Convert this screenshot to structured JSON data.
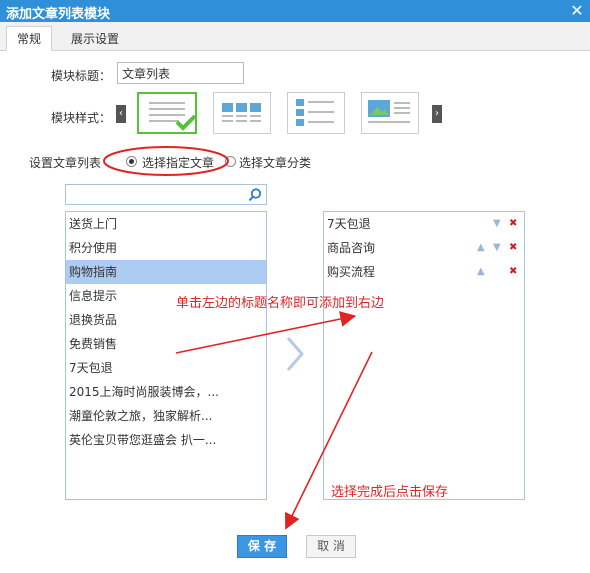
{
  "dialog": {
    "title": "添加文章列表模块",
    "close_glyph": "✕"
  },
  "tabs": [
    {
      "label": "常规"
    },
    {
      "label": "展示设置"
    }
  ],
  "form": {
    "module_title_label": "模块标题：",
    "module_title_value": "文章列表",
    "module_style_label": "模块样式：",
    "article_list_label": "设置文章列表",
    "radio_specific": "选择指定文章",
    "radio_category": "选择文章分类",
    "search_placeholder": ""
  },
  "left_list": [
    "送货上门",
    "积分使用",
    "购物指南",
    "信息提示",
    "退换货品",
    "免费销售",
    "7天包退",
    "2015上海时尚服装博会，...",
    "潮童伦敦之旅，独家解析...",
    "英伦宝贝带您逛盛会 扒一..."
  ],
  "left_selected_index": 2,
  "right_list": [
    {
      "label": "7天包退"
    },
    {
      "label": "商品咨询"
    },
    {
      "label": "购买流程"
    }
  ],
  "buttons": {
    "save": "保 存",
    "cancel": "取 消"
  },
  "annotations": {
    "tip_add": "单击左边的标题名称即可添加到右边",
    "tip_save": "选择完成后点击保存"
  },
  "colors": {
    "titlebar": "#2f8fd8",
    "annotation": "#e02424",
    "selected_row": "#acccf3",
    "save_button": "#3b97e3",
    "selected_style_border": "#55c23a"
  },
  "icons": {
    "close": "close-icon",
    "search": "search-icon",
    "move_up": "arrow-up-icon",
    "move_down": "arrow-down-icon",
    "delete": "delete-icon",
    "transfer": "chevron-right-icon"
  }
}
